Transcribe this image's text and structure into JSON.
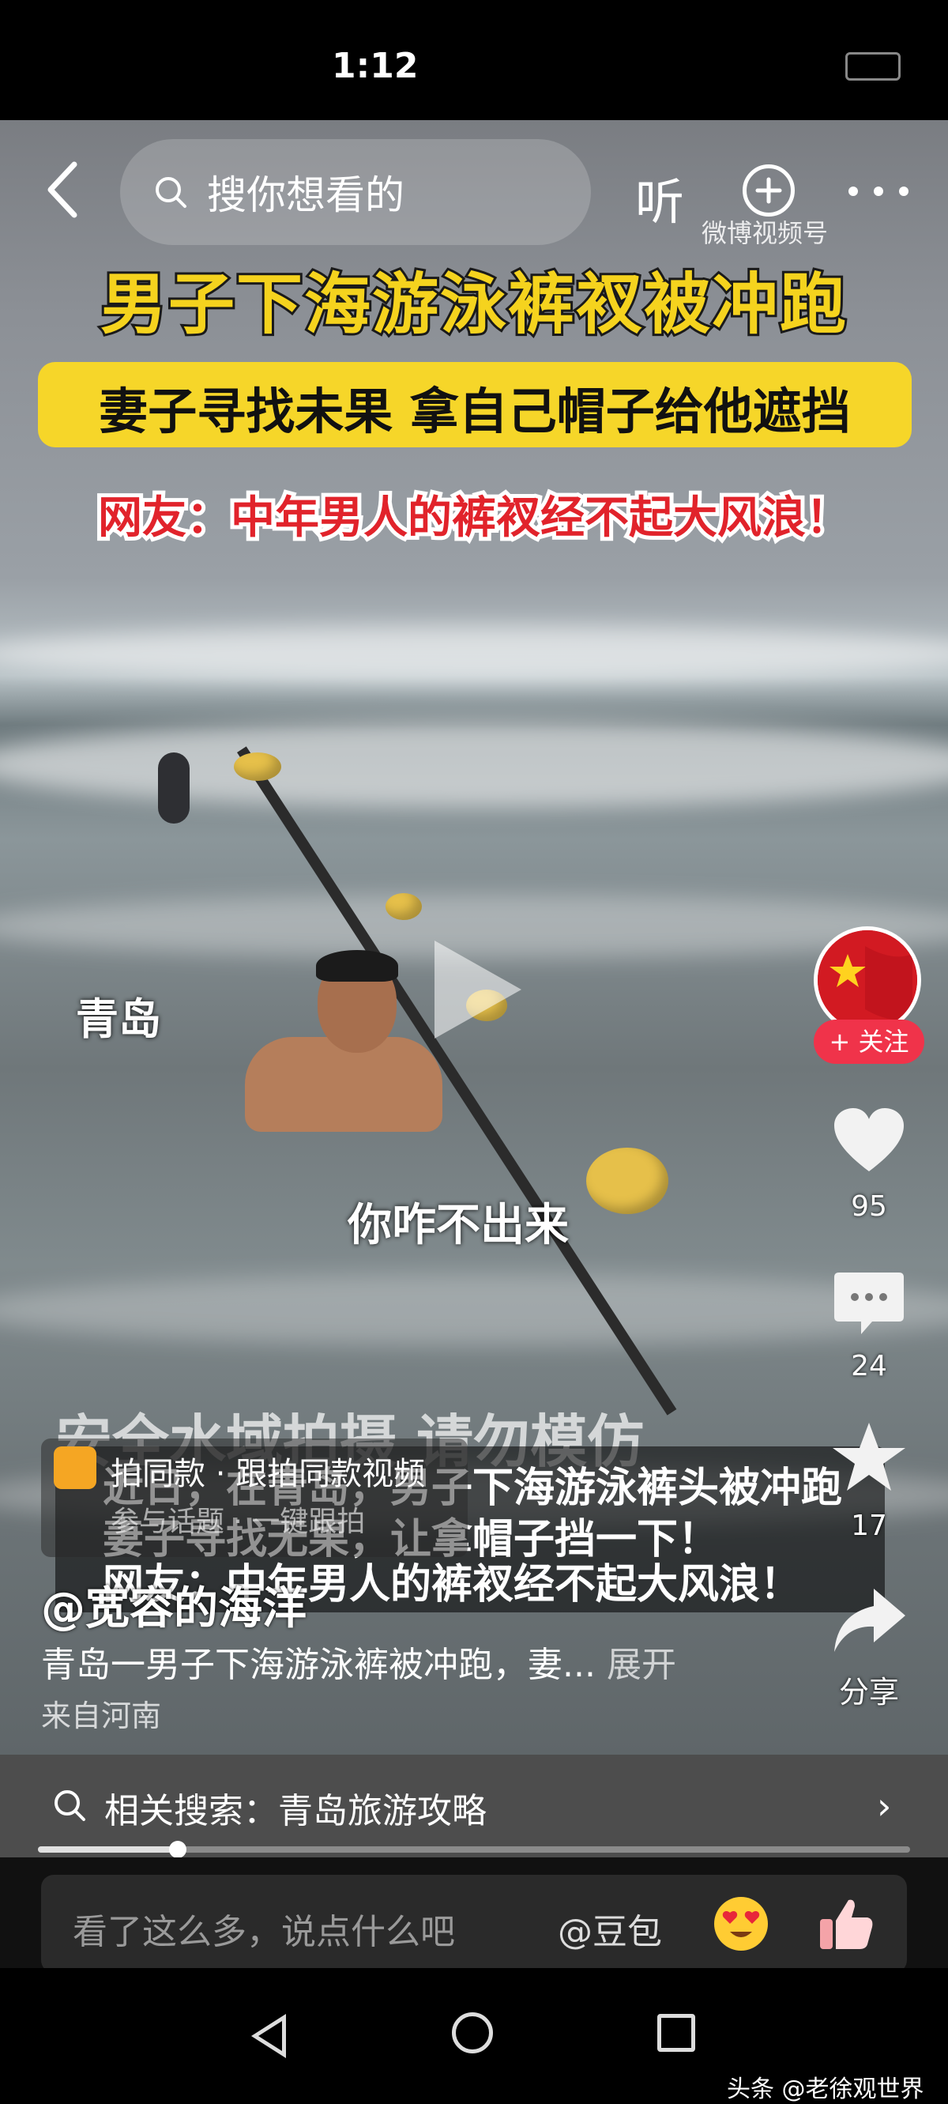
{
  "status_bar": {
    "time": "1:12"
  },
  "top_nav": {
    "search_placeholder": "搜你想看的",
    "listen_label": "听"
  },
  "video": {
    "headline_main": "男子下海游泳裤衩被冲跑",
    "headline_sub": "妻子寻找未果 拿自己帽子给他遮挡",
    "headline_comment": "网友：中年男人的裤衩经不起大风浪！",
    "watermark": "微博视频号",
    "location": "青岛",
    "caption": "你咋不出来",
    "safety_banner": "安全水域拍摄 请勿模仿",
    "subtitles": [
      "近日，在青岛，男子下海游泳裤头被冲跑",
      "妻子寻找无果，让拿帽子挡一下！",
      "网友：中年男人的裤衩经不起大风浪！"
    ]
  },
  "right_rail": {
    "follow_label": "+ 关注",
    "like_count": "95",
    "comment_count": "24",
    "favorite_count": "17",
    "share_label": "分享"
  },
  "info": {
    "same_style": "拍同款 · 跟拍同款视频",
    "topic_hint": "参与话题 · 一键跟拍",
    "author": "@宽容的海洋",
    "description": "青岛一男子下海游泳裤被冲跑，妻...",
    "expand_label": "展开",
    "from_location": "来自河南"
  },
  "related_search": {
    "text": "相关搜索：青岛旅游攻略"
  },
  "progress": {
    "fraction": 0.16
  },
  "comment_bar": {
    "placeholder": "看了这么多，说点什么吧",
    "doubao_label": "@豆包"
  },
  "bottom_watermark": "头条 @老徐观世界",
  "colors": {
    "headline_yellow": "#f5d31e",
    "headline_red": "#e1232b",
    "follow_red": "#f0334a"
  }
}
